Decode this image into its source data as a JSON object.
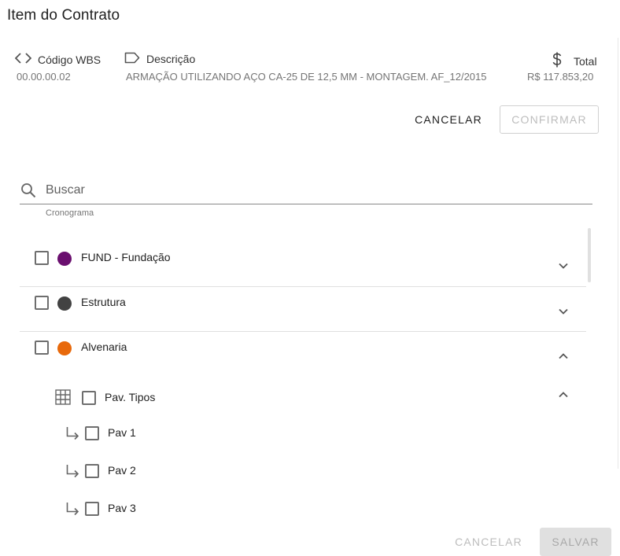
{
  "dialog": {
    "title": "Item do Contrato"
  },
  "info": {
    "code_label": "Código WBS",
    "code_value": "00.00.00.02",
    "description_label": "Descrição",
    "description_value": "ARMAÇÃO UTILIZANDO AÇO CA-25 DE 12,5 MM - MONTAGEM. AF_12/2015",
    "total_label": "Total",
    "total_value": "R$ 117.853,20"
  },
  "actions_top": {
    "cancel_label": "CANCELAR",
    "confirm_label": "CONFIRMAR"
  },
  "search": {
    "placeholder": "Buscar",
    "value": "",
    "helper": "Cronograma"
  },
  "tree": {
    "groups": [
      {
        "label": "FUND - Fundação",
        "color": "#6a0f6f",
        "expanded": false,
        "checked": false
      },
      {
        "label": "Estrutura",
        "color": "#424242",
        "expanded": false,
        "checked": false
      },
      {
        "label": "Alvenaria",
        "color": "#e8690b",
        "expanded": true,
        "checked": false
      }
    ],
    "subgroup": {
      "label": "Pav. Tipos",
      "icon": "grid-icon",
      "expanded": true,
      "checked": false
    },
    "leaves": [
      {
        "label": "Pav 1",
        "checked": false
      },
      {
        "label": "Pav 2",
        "checked": false
      },
      {
        "label": "Pav 3",
        "checked": false
      }
    ]
  },
  "actions_bottom": {
    "cancel_label": "CANCELAR",
    "save_label": "SALVAR"
  },
  "colors": {
    "primary_text": "#212121",
    "muted_text": "#757575",
    "disabled": "#bdbdbd",
    "divider": "#e0e0e0"
  },
  "icons": {
    "code": "code-brackets-icon",
    "description": "label-tag-icon",
    "total": "dollar-icon",
    "search": "search-icon",
    "expand": "chevron-down-icon",
    "collapse": "chevron-up-icon",
    "child": "subdirectory-arrow-icon"
  }
}
